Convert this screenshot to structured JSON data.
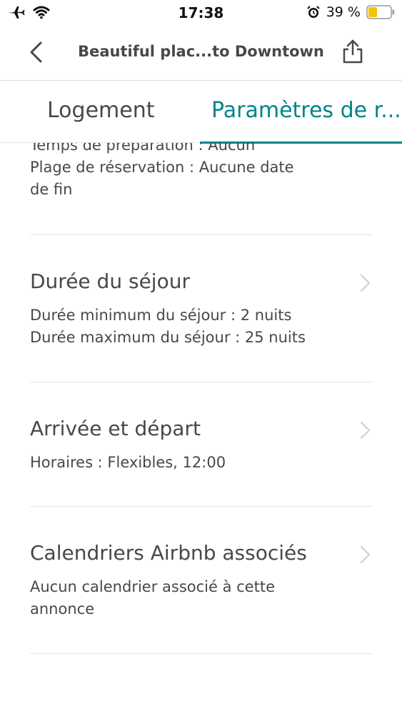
{
  "status_bar": {
    "time": "17:38",
    "battery_percent": "39 %",
    "battery_level": 0.39,
    "battery_color": "#f5c400"
  },
  "nav": {
    "title": "Beautiful plac...to Downtown",
    "back_icon": "chevron-left-icon",
    "share_icon": "share-icon"
  },
  "tabs": [
    {
      "label": "Logement",
      "active": false
    },
    {
      "label": "Paramètres de r...",
      "active": true
    }
  ],
  "accent_color": "#008489",
  "partial_section": {
    "lines": [
      "Temps de préparation : Aucun",
      "Plage de réservation : Aucune date",
      "de fin"
    ]
  },
  "sections": [
    {
      "title": "Durée du séjour",
      "lines": [
        "Durée minimum du séjour : 2 nuits",
        "Durée maximum du séjour : 25 nuits"
      ]
    },
    {
      "title": "Arrivée et départ",
      "lines": [
        "Horaires : Flexibles, 12:00"
      ]
    },
    {
      "title": "Calendriers Airbnb associés",
      "lines": [
        "Aucun calendrier associé à cette",
        "annonce"
      ]
    }
  ]
}
